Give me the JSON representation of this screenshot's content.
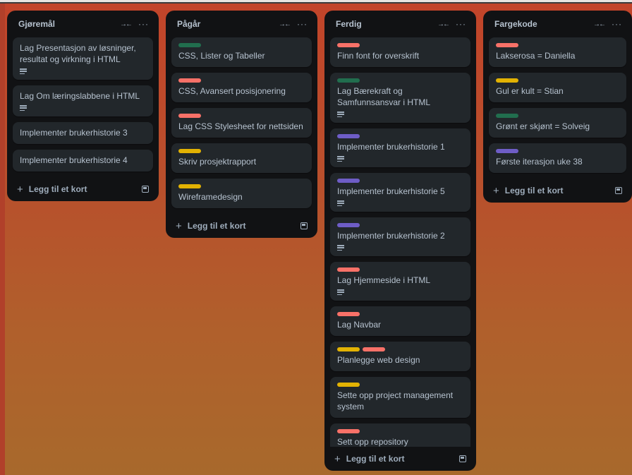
{
  "colors": {
    "red": "#f87168",
    "green": "#216e4e",
    "yellow": "#e2b203",
    "purple": "#6e5dc6"
  },
  "add_card_label": "Legg til et kort",
  "lists": [
    {
      "title": "Gjøremål",
      "cards": [
        {
          "title": "Lag Presentasjon av løsninger, resultat og virkning i HTML",
          "labels": [],
          "has_description": true
        },
        {
          "title": "Lag Om læringslabbene i HTML",
          "labels": [],
          "has_description": true
        },
        {
          "title": "Implementer brukerhistorie 3",
          "labels": [],
          "has_description": false
        },
        {
          "title": "Implementer brukerhistorie 4",
          "labels": [],
          "has_description": false
        }
      ]
    },
    {
      "title": "Pågår",
      "cards": [
        {
          "title": "CSS, Lister og Tabeller",
          "labels": [
            "green"
          ],
          "has_description": false
        },
        {
          "title": "CSS, Avansert posisjonering",
          "labels": [
            "red"
          ],
          "has_description": false
        },
        {
          "title": "Lag CSS Stylesheet for nettsiden",
          "labels": [
            "red"
          ],
          "has_description": false
        },
        {
          "title": "Skriv prosjektrapport",
          "labels": [
            "yellow"
          ],
          "has_description": false
        },
        {
          "title": "Wireframedesign",
          "labels": [
            "yellow"
          ],
          "has_description": false
        }
      ]
    },
    {
      "title": "Ferdig",
      "cards": [
        {
          "title": "Finn font for overskrift",
          "labels": [
            "red"
          ],
          "has_description": false
        },
        {
          "title": "Lag Bærekraft og Samfunnsansvar i HTML",
          "labels": [
            "green"
          ],
          "has_description": true
        },
        {
          "title": "Implementer brukerhistorie 1",
          "labels": [
            "purple"
          ],
          "has_description": true
        },
        {
          "title": "Implementer brukerhistorie 5",
          "labels": [
            "purple"
          ],
          "has_description": true
        },
        {
          "title": "Implementer brukerhistorie 2",
          "labels": [
            "purple"
          ],
          "has_description": true
        },
        {
          "title": "Lag Hjemmeside i HTML",
          "labels": [
            "red"
          ],
          "has_description": true
        },
        {
          "title": "Lag Navbar",
          "labels": [
            "red"
          ],
          "has_description": false
        },
        {
          "title": "Planlegge web design",
          "labels": [
            "yellow",
            "red"
          ],
          "has_description": false
        },
        {
          "title": "Sette opp project management system",
          "labels": [
            "yellow"
          ],
          "has_description": false
        },
        {
          "title": "Sett opp repository",
          "labels": [
            "red"
          ],
          "has_description": false
        }
      ]
    },
    {
      "title": "Fargekode",
      "cards": [
        {
          "title": "Lakserosa = Daniella",
          "labels": [
            "red"
          ],
          "has_description": false
        },
        {
          "title": "Gul er kult = Stian",
          "labels": [
            "yellow"
          ],
          "has_description": false
        },
        {
          "title": "Grønt er skjønt = Solveig",
          "labels": [
            "green"
          ],
          "has_description": false
        },
        {
          "title": "Første iterasjon uke 38",
          "labels": [
            "purple"
          ],
          "has_description": false
        }
      ]
    }
  ]
}
